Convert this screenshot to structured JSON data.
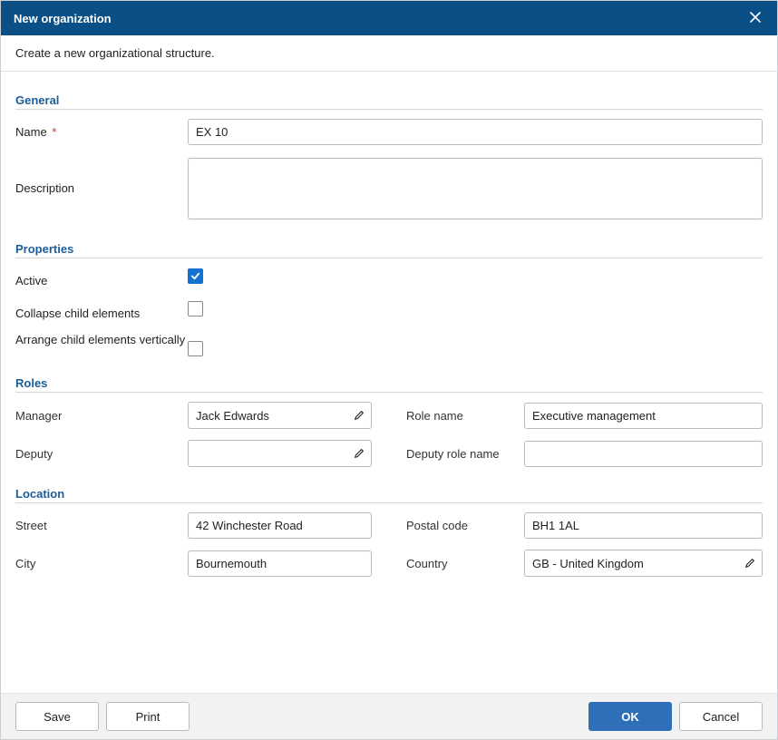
{
  "titlebar": {
    "title": "New organization"
  },
  "subtitle": "Create a new organizational structure.",
  "sections": {
    "general": {
      "header": "General",
      "name": {
        "label": "Name",
        "value": "EX 10"
      },
      "description": {
        "label": "Description",
        "value": ""
      }
    },
    "properties": {
      "header": "Properties",
      "active": {
        "label": "Active",
        "checked": true
      },
      "collapse": {
        "label": "Collapse child elements",
        "checked": false
      },
      "arrange": {
        "label": "Arrange child elements vertically",
        "checked": false
      }
    },
    "roles": {
      "header": "Roles",
      "manager": {
        "label": "Manager",
        "value": "Jack Edwards"
      },
      "role_name": {
        "label": "Role name",
        "value": "Executive management"
      },
      "deputy": {
        "label": "Deputy",
        "value": ""
      },
      "deputy_role": {
        "label": "Deputy role name",
        "value": ""
      }
    },
    "location": {
      "header": "Location",
      "street": {
        "label": "Street",
        "value": "42 Winchester Road"
      },
      "postal": {
        "label": "Postal code",
        "value": "BH1 1AL"
      },
      "city": {
        "label": "City",
        "value": "Bournemouth"
      },
      "country": {
        "label": "Country",
        "value": "GB - United Kingdom"
      }
    }
  },
  "footer": {
    "save": "Save",
    "print": "Print",
    "ok": "OK",
    "cancel": "Cancel"
  }
}
